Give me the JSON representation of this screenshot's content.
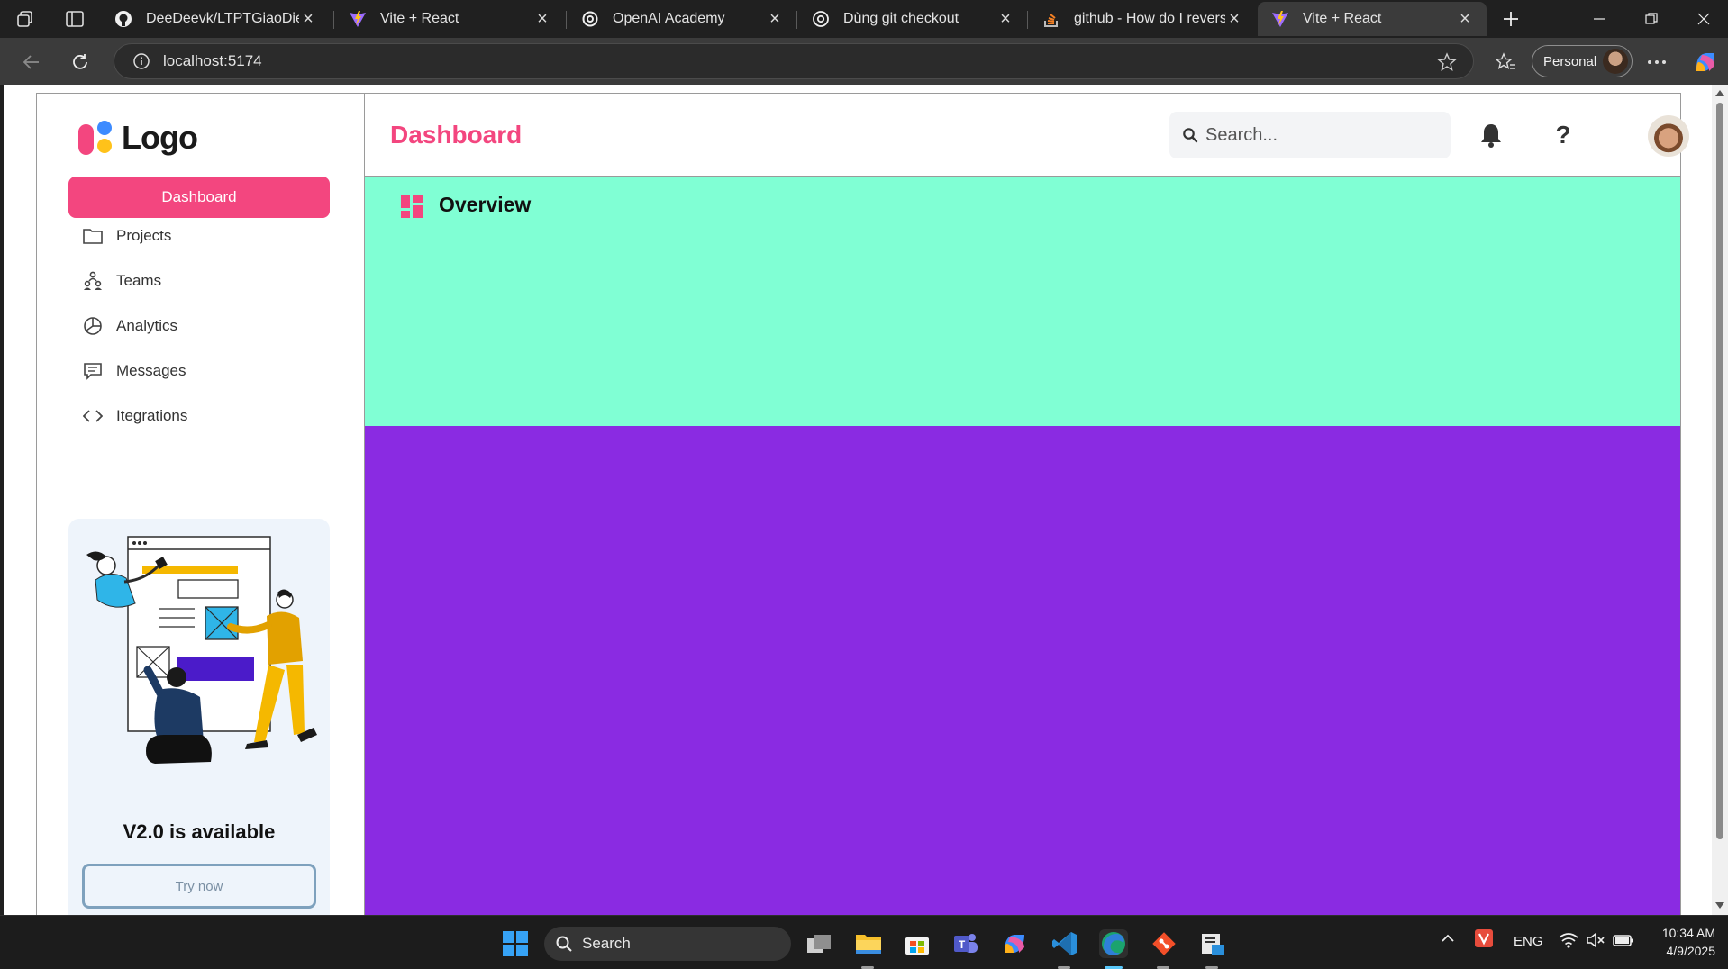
{
  "browser": {
    "tabs": [
      {
        "title": "DeeDeevk/LTPTGiaoDien_N",
        "icon": "github-icon"
      },
      {
        "title": "Vite + React",
        "icon": "vite-icon"
      },
      {
        "title": "OpenAI Academy",
        "icon": "openai-icon"
      },
      {
        "title": "Dùng git checkout",
        "icon": "globe-icon"
      },
      {
        "title": "github - How do I reverse a",
        "icon": "stackoverflow-icon"
      },
      {
        "title": "Vite + React",
        "icon": "vite-icon",
        "active": true
      }
    ],
    "url": "localhost:5174",
    "profile_label": "Personal"
  },
  "sidebar": {
    "logo_text": "Logo",
    "active_item": "Dashboard",
    "items": [
      {
        "label": "Projects",
        "icon": "folder-icon"
      },
      {
        "label": "Teams",
        "icon": "teams-icon"
      },
      {
        "label": "Analytics",
        "icon": "pie-chart-icon"
      },
      {
        "label": "Messages",
        "icon": "message-icon"
      },
      {
        "label": "Itegrations",
        "icon": "code-icon"
      }
    ],
    "promo": {
      "heading": "V2.0 is available",
      "button_label": "Try now"
    }
  },
  "header": {
    "title": "Dashboard",
    "search_placeholder": "Search...",
    "help_label": "?"
  },
  "overview": {
    "title": "Overview"
  },
  "taskbar": {
    "search_label": "Search",
    "language": "ENG",
    "time": "10:34 AM",
    "date": "4/9/2025"
  },
  "colors": {
    "brand_pink": "#f3467f",
    "overview_bg": "#80ffd4",
    "content_purple": "#8a2be2"
  }
}
